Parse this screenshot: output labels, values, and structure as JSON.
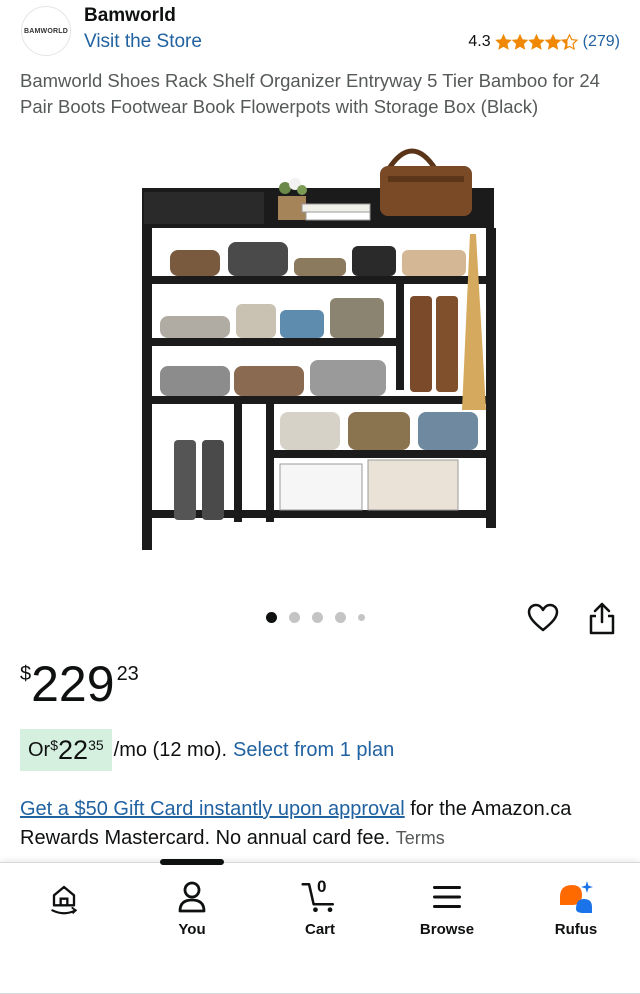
{
  "header": {
    "logo_text": "BAMWORLD",
    "brand_name": "Bamworld",
    "visit_store": "Visit the Store",
    "rating_value": "4.3",
    "rating_stars": 4.3,
    "rating_count": "(279)"
  },
  "product": {
    "title": "Bamworld Shoes Rack Shelf Organizer Entryway 5 Tier Bamboo for 24 Pair Boots Footwear Book Flowerpots with Storage Box (Black)",
    "image_dots": 5,
    "active_dot": 0
  },
  "price": {
    "symbol": "$",
    "whole": "229",
    "fraction": "23"
  },
  "monthly": {
    "prefix": "Or ",
    "symbol": "$",
    "whole": "22",
    "fraction": "35",
    "suffix": "/mo (12 mo).",
    "select_plan": "Select from 1 plan"
  },
  "gift": {
    "link_text": "Get a $50 Gift Card instantly upon approval",
    "rest_text": " for the Amazon.ca Rewards Mastercard. No annual card fee. ",
    "terms": "Terms"
  },
  "bottom_nav": {
    "items": [
      {
        "label": "",
        "icon": "home-icon"
      },
      {
        "label": "You",
        "icon": "user-icon"
      },
      {
        "label": "Cart",
        "icon": "cart-icon",
        "badge": "0"
      },
      {
        "label": "Browse",
        "icon": "menu-icon"
      },
      {
        "label": "Rufus",
        "icon": "rufus-icon"
      }
    ]
  },
  "colors": {
    "link": "#2162a1",
    "star": "#f08804",
    "badge_bg": "#d6f0e0",
    "rufus_orange": "#ff6a00",
    "rufus_blue": "#1a73e8"
  }
}
